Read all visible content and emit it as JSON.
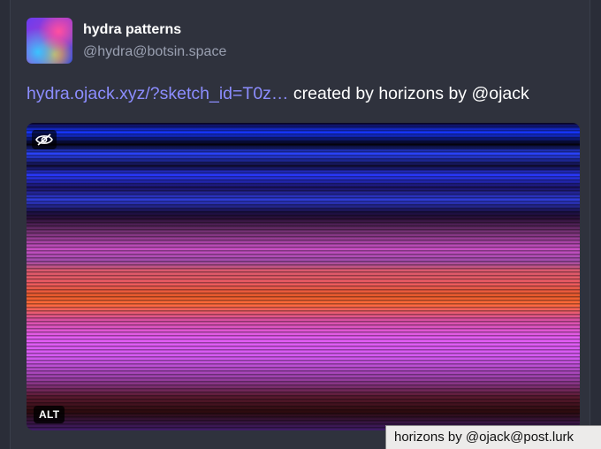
{
  "post": {
    "display_name": "hydra patterns",
    "handle": "@hydra@botsin.space",
    "link_text": "hydra.ojack.xyz/?sketch_id=T0z…",
    "content_rest": " created by horizons by @ojack"
  },
  "media": {
    "alt_badge": "ALT",
    "hide_icon": "eye-slash-icon",
    "alt_tooltip": "horizons by @ojack@post.lurk"
  }
}
